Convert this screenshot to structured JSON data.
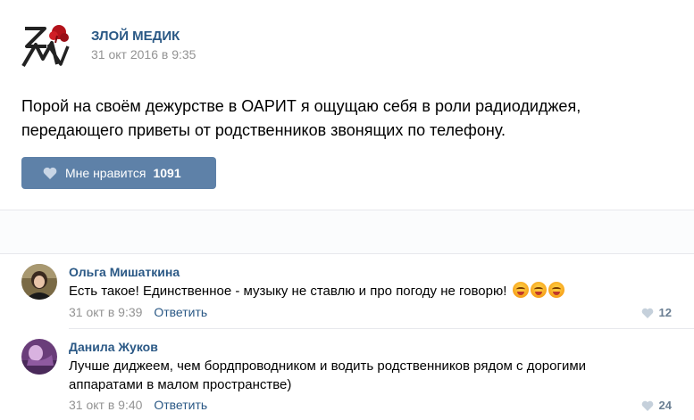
{
  "post": {
    "author": "ЗЛОЙ МЕДИК",
    "date": "31 окт 2016 в 9:35",
    "text_line1": "Порой на своём дежурстве в ОАРИТ я ощущаю себя в роли радиодиджея,",
    "text_line2": "передающего приветы от родственников звонящих по телефону.",
    "like_label": "Мне нравится",
    "like_count": "1091"
  },
  "comments": [
    {
      "author": "Ольга Мишаткина",
      "text": "Есть такое! Единственное - музыку не ставлю и про погоду не говорю!",
      "emoji_count": 3,
      "date": "31 окт в 9:39",
      "reply": "Ответить",
      "likes": "12"
    },
    {
      "author": "Данила Жуков",
      "text": "Лучше диджеем, чем бордпроводником и водить родственников рядом с дорогими аппаратами в малом пространстве)",
      "date": "31 окт в 9:40",
      "reply": "Ответить",
      "likes": "24"
    }
  ],
  "colors": {
    "link": "#2a5885",
    "like_button": "#5e81a8",
    "meta": "#939393"
  },
  "icons": {
    "like": "heart-icon",
    "emoji": "angry-face-emoji"
  }
}
